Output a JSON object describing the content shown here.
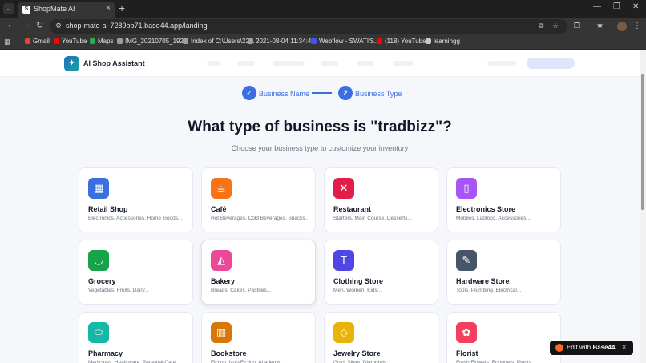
{
  "browser": {
    "tab_title": "ShopMate AI",
    "url": "shop-mate-ai-7289bb71.base44.app/landing",
    "bookmarks": [
      {
        "label": "Gmail",
        "color": "#ea4335"
      },
      {
        "label": "YouTube",
        "color": "#ff0000"
      },
      {
        "label": "Maps",
        "color": "#34a853"
      },
      {
        "label": "IMG_20210705_192...",
        "color": "#9aa0a6"
      },
      {
        "label": "Index of C:\\Users\\22...",
        "color": "#9aa0a6"
      },
      {
        "label": "2021-08-04 11:34:4...",
        "color": "#9aa0a6"
      },
      {
        "label": "Webflow - SWATI'S...",
        "color": "#4353ff"
      },
      {
        "label": "(118) YouTube",
        "color": "#ff0000"
      },
      {
        "label": "learningg",
        "color": "#c8c8c8"
      }
    ]
  },
  "header": {
    "app_name": "AI Shop Assistant"
  },
  "stepper": {
    "step1": {
      "number": "✓",
      "label": "Business Name"
    },
    "step2": {
      "number": "2",
      "label": "Business Type"
    }
  },
  "page": {
    "title": "What type of business is \"tradbizz\"?",
    "subtitle": "Choose your business type to customize your inventory"
  },
  "business_types": [
    {
      "title": "Retail Shop",
      "desc": "Electronics, Accessories, Home Goods...",
      "icon": "store-icon",
      "glyph": "▦",
      "color": "#3b6fe0"
    },
    {
      "title": "Café",
      "desc": "Hot Beverages, Cold Beverages, Snacks...",
      "icon": "coffee-icon",
      "glyph": "☕",
      "color": "#f97316"
    },
    {
      "title": "Restaurant",
      "desc": "Starters, Main Course, Desserts...",
      "icon": "utensils-icon",
      "glyph": "✕",
      "color": "#e11d48"
    },
    {
      "title": "Electronics Store",
      "desc": "Mobiles, Laptops, Accessories...",
      "icon": "smartphone-icon",
      "glyph": "▯",
      "color": "#a855f7"
    },
    {
      "title": "Grocery",
      "desc": "Vegetables, Fruits, Dairy...",
      "icon": "basket-icon",
      "glyph": "◡",
      "color": "#16a34a"
    },
    {
      "title": "Bakery",
      "desc": "Breads, Cakes, Pastries...",
      "icon": "cake-icon",
      "glyph": "◭",
      "color": "#ec4899"
    },
    {
      "title": "Clothing Store",
      "desc": "Men, Women, Kids...",
      "icon": "shirt-icon",
      "glyph": "T",
      "color": "#4f46e5"
    },
    {
      "title": "Hardware Store",
      "desc": "Tools, Plumbing, Electrical...",
      "icon": "wrench-icon",
      "glyph": "✎",
      "color": "#475569"
    },
    {
      "title": "Pharmacy",
      "desc": "Medicines, Healthcare, Personal Care...",
      "icon": "pill-icon",
      "glyph": "⬭",
      "color": "#14b8a6"
    },
    {
      "title": "Bookstore",
      "desc": "Fiction, Non-Fiction, Academic...",
      "icon": "book-icon",
      "glyph": "▥",
      "color": "#d97706"
    },
    {
      "title": "Jewelry Store",
      "desc": "Gold, Silver, Diamonds...",
      "icon": "gem-icon",
      "glyph": "◇",
      "color": "#eab308"
    },
    {
      "title": "Florist",
      "desc": "Fresh Flowers, Bouquets, Plants...",
      "icon": "flower-icon",
      "glyph": "✿",
      "color": "#f43f5e"
    }
  ],
  "edit_badge": {
    "prefix": "Edit with",
    "brand": "Base44",
    "close": "×"
  }
}
